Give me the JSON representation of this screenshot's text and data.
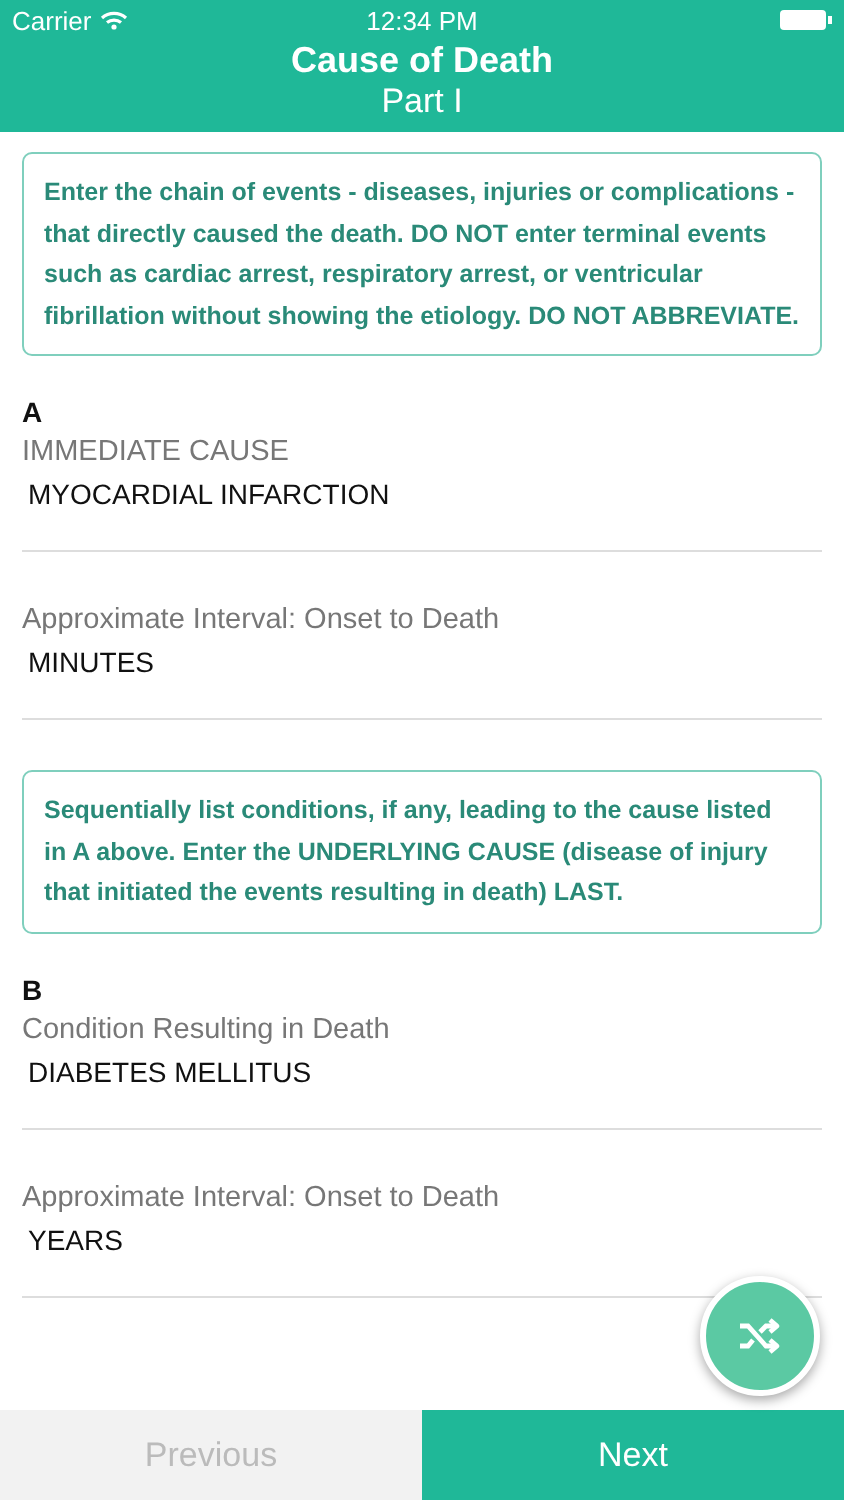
{
  "status_bar": {
    "carrier": "Carrier",
    "time": "12:34 PM"
  },
  "header": {
    "title": "Cause of Death",
    "subtitle": "Part I"
  },
  "sections": [
    {
      "notice": "Enter the chain of events - diseases, injuries or complications - that directly caused the death. DO NOT enter terminal events such as cardiac arrest, respiratory arrest, or ventricular fibrillation without showing the etiology. DO NOT ABBREVIATE.",
      "letter": "A",
      "fields": [
        {
          "label": "IMMEDIATE CAUSE",
          "value": "MYOCARDIAL INFARCTION"
        },
        {
          "label": "Approximate Interval: Onset to Death",
          "value": "MINUTES"
        }
      ]
    },
    {
      "notice": "Sequentially list conditions, if any, leading to the cause listed in A above. Enter the UNDERLYING CAUSE (disease of injury that initiated the events resulting in death) LAST.",
      "letter": "B",
      "fields": [
        {
          "label": "Condition Resulting in Death",
          "value": "DIABETES MELLITUS"
        },
        {
          "label": "Approximate Interval: Onset to Death",
          "value": "YEARS"
        }
      ]
    }
  ],
  "footer": {
    "buttons": [
      {
        "label": "Previous",
        "disabled": true
      },
      {
        "label": "Next",
        "disabled": false
      }
    ]
  }
}
